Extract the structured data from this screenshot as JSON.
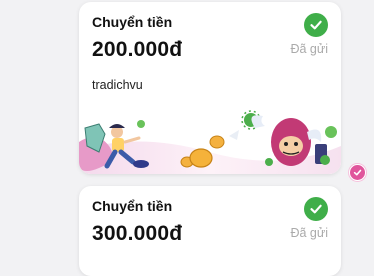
{
  "transfers": [
    {
      "title": "Chuyển tiền",
      "amount": "200.000đ",
      "status": "Đã gửi",
      "note": "tradichvu",
      "status_color": "#3fae49"
    },
    {
      "title": "Chuyển tiền",
      "amount": "300.000đ",
      "status": "Đã gửi",
      "status_color": "#3fae49"
    }
  ],
  "banner_icon": "momo-mascot-illustration",
  "selection_icon": "selected-check-icon",
  "accent_color": "#e0569c"
}
